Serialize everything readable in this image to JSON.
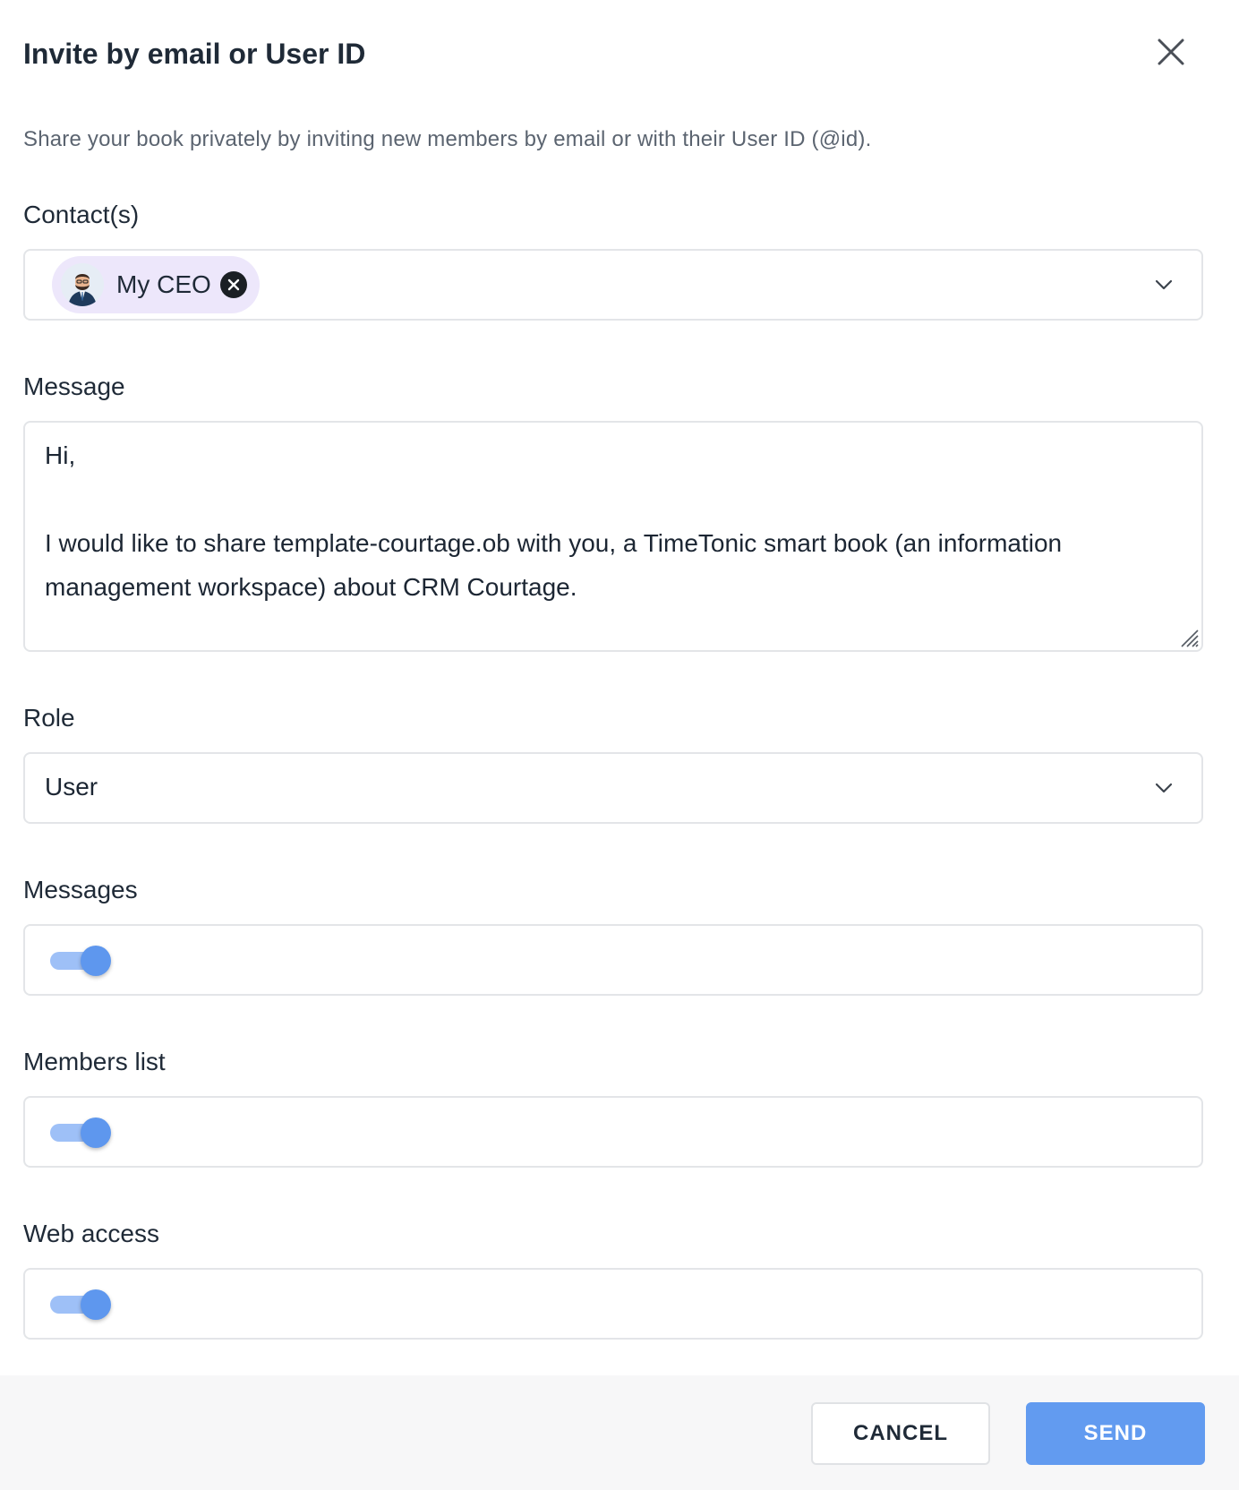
{
  "dialog": {
    "title": "Invite by email or User ID",
    "subtitle": "Share your book privately by inviting new members by email or with their User ID (@id).",
    "close_icon": "close-icon"
  },
  "contacts": {
    "label": "Contact(s)",
    "chips": [
      {
        "label": "My CEO",
        "avatar": "ceo-avatar"
      }
    ],
    "dropdown_icon": "chevron-down-icon"
  },
  "message": {
    "label": "Message",
    "value": "Hi,\n\nI would like to share template-courtage.ob with you, a TimeTonic smart book (an information management workspace) about CRM Courtage."
  },
  "role": {
    "label": "Role",
    "value": "User",
    "dropdown_icon": "chevron-down-icon"
  },
  "messages_toggle": {
    "label": "Messages",
    "on": true
  },
  "members_list_toggle": {
    "label": "Members list",
    "on": true
  },
  "web_access_toggle": {
    "label": "Web access",
    "on": true
  },
  "footer": {
    "cancel_label": "CANCEL",
    "send_label": "SEND"
  },
  "colors": {
    "accent": "#629bf0",
    "toggle_track": "#9ec0f7",
    "chip_background": "#ede7fb",
    "border": "#e3e5e8"
  }
}
